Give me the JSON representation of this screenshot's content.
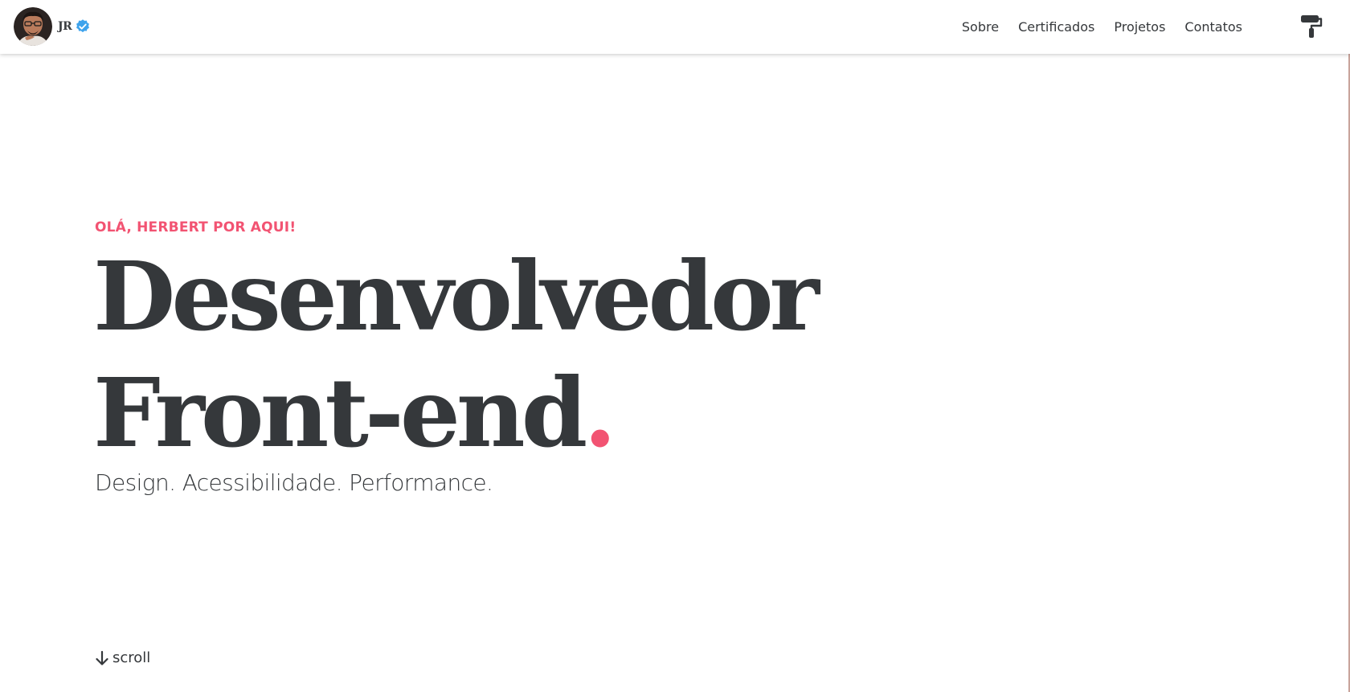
{
  "header": {
    "initials": "JR",
    "nav": [
      "Sobre",
      "Certificados",
      "Projetos",
      "Contatos"
    ]
  },
  "hero": {
    "greeting": "OLÁ, HERBERT POR AQUI!",
    "title_line1": "Desenvolvedor",
    "title_line2": "Front-end",
    "title_dot": ".",
    "tagline": "Design. Acessibilidade. Performance.",
    "scroll_label": "scroll"
  },
  "icons": {
    "verified": "verified-badge-icon",
    "theme": "paint-roller-icon",
    "scroll": "arrow-down-icon"
  },
  "colors": {
    "accent": "#f25372",
    "text": "#35383b",
    "verified": "#3ea3ec",
    "background": "#ffffff"
  }
}
